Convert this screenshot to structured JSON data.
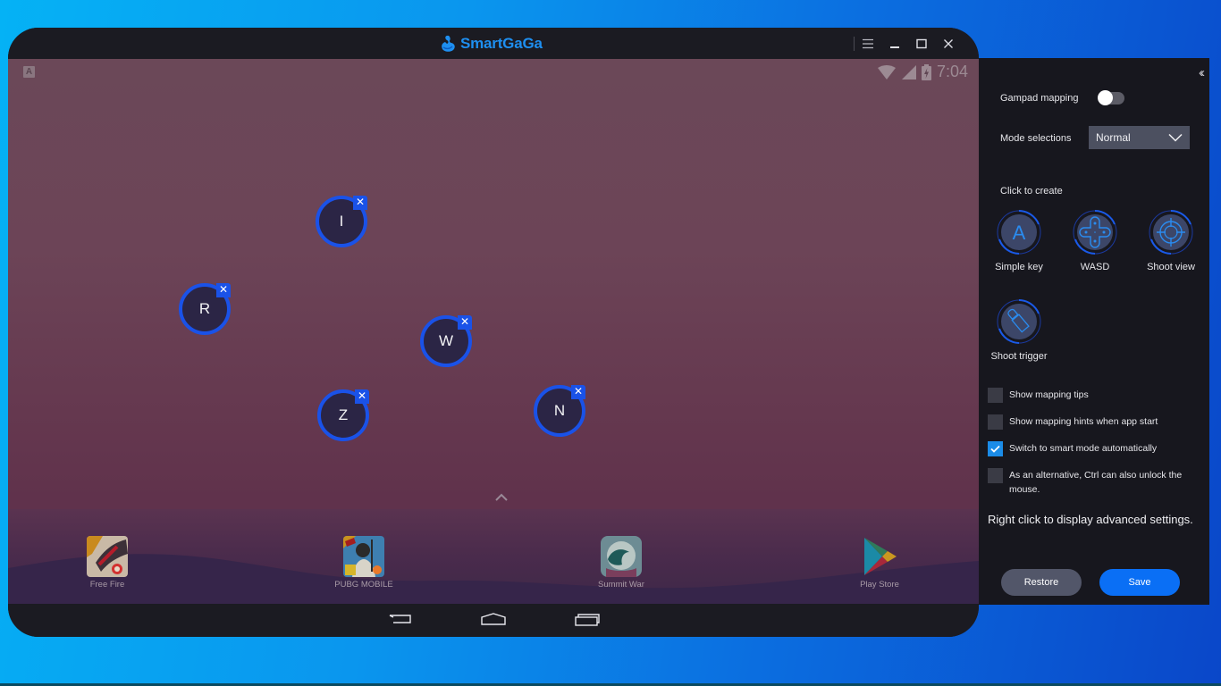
{
  "window": {
    "title": "SmartGaGa",
    "controls": [
      "menu-icon",
      "minimize-icon",
      "maximize-icon",
      "close-icon"
    ]
  },
  "android": {
    "status_bar": {
      "notification_badge": "A",
      "icons": [
        "wifi-icon",
        "signal-icon",
        "battery-charging-icon"
      ],
      "time": "7:04"
    },
    "key_mappings": [
      {
        "key": "I"
      },
      {
        "key": "R"
      },
      {
        "key": "W"
      },
      {
        "key": "Z"
      },
      {
        "key": "N"
      }
    ],
    "remove_glyph": "✕",
    "dock_apps": [
      {
        "label": "Free Fire"
      },
      {
        "label": "PUBG MOBILE"
      },
      {
        "label": "Summit War"
      },
      {
        "label": "Play Store"
      }
    ],
    "nav_buttons": [
      "back-icon",
      "home-icon",
      "recents-icon"
    ]
  },
  "panel": {
    "collapse_glyph": "‹‹",
    "gamepad_mapping": {
      "label": "Gampad mapping",
      "enabled": false
    },
    "mode": {
      "label": "Mode selections",
      "value": "Normal"
    },
    "create_heading": "Click to create",
    "tools": [
      {
        "label": "Simple key",
        "glyph": "A"
      },
      {
        "label": "WASD"
      },
      {
        "label": "Shoot view"
      },
      {
        "label": "Shoot trigger"
      }
    ],
    "options": [
      {
        "label": "Show mapping tips",
        "checked": false
      },
      {
        "label": "Show mapping hints when app start",
        "checked": false
      },
      {
        "label": "Switch to smart mode automatically",
        "checked": true
      },
      {
        "label": "As an alternative, Ctrl can also unlock the mouse.",
        "checked": false
      }
    ],
    "advanced_hint": "Right click to display advanced settings.",
    "restore_label": "Restore",
    "save_label": "Save"
  },
  "colors": {
    "brand": "#1e8ff0",
    "accent_blue": "#0a6ff5",
    "key_ring": "#1a52e8",
    "panel_bg": "#17171e",
    "checked": "#1b8ce8"
  }
}
